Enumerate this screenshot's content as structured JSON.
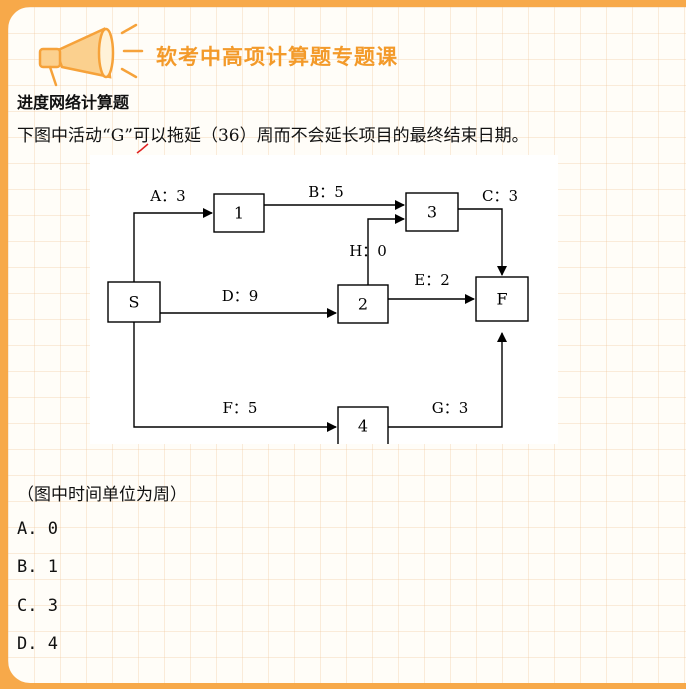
{
  "header": {
    "course_title": "软考中高项计算题专题课"
  },
  "section_title": "进度网络计算题",
  "question": "下图中活动“G”可以拖延（36）周而不会延长项目的最终结束日期。",
  "diagram": {
    "nodes": [
      "S",
      "1",
      "2",
      "3",
      "4",
      "F"
    ],
    "edges": [
      {
        "label": "A：3"
      },
      {
        "label": "B：5"
      },
      {
        "label": "C：3"
      },
      {
        "label": "D：9"
      },
      {
        "label": "E：2"
      },
      {
        "label": "H：0"
      },
      {
        "label": "F：5"
      },
      {
        "label": "G：3"
      }
    ]
  },
  "unit_note": "（图中时间单位为周）",
  "options": [
    "A. 0",
    "B. 1",
    "C. 3",
    "D. 4"
  ],
  "colors": {
    "accent": "#f39a2a",
    "border": "#f7a94a"
  }
}
